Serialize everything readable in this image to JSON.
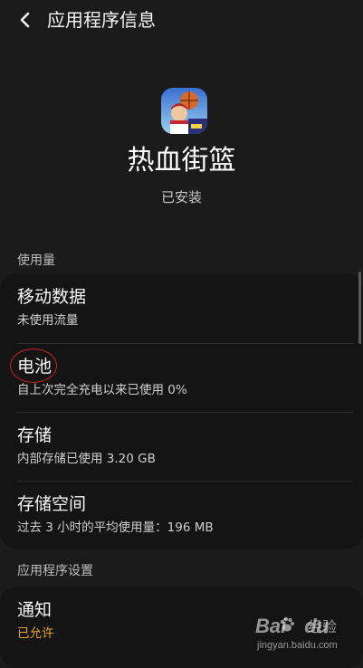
{
  "header": {
    "title": "应用程序信息",
    "back_icon": "chevron-left-icon"
  },
  "app": {
    "name": "热血街篮",
    "status": "已安装",
    "icon": "basketball-game-app-icon"
  },
  "usage": {
    "section_label": "使用量",
    "items": [
      {
        "label": "移动数据",
        "detail": "未使用流量"
      },
      {
        "label": "电池",
        "detail": "自上次完全充电以来已使用 0%"
      },
      {
        "label": "存储",
        "detail": "内部存储已使用 3.20 GB"
      },
      {
        "label": "存储空间",
        "detail": "过去 3 小时的平均使用量：196 MB"
      }
    ]
  },
  "settings": {
    "section_label": "应用程序设置",
    "items": [
      {
        "label": "通知",
        "detail": "已允许"
      }
    ]
  },
  "watermark": {
    "logo": "Bai",
    "logo_suffix": "du",
    "brand": "经验",
    "url": "jingyan.baidu.com"
  },
  "colors": {
    "background": "#1b1b1b",
    "card": "#141414",
    "accent": "#e8a524",
    "annotation_circle": "#d0201c"
  }
}
